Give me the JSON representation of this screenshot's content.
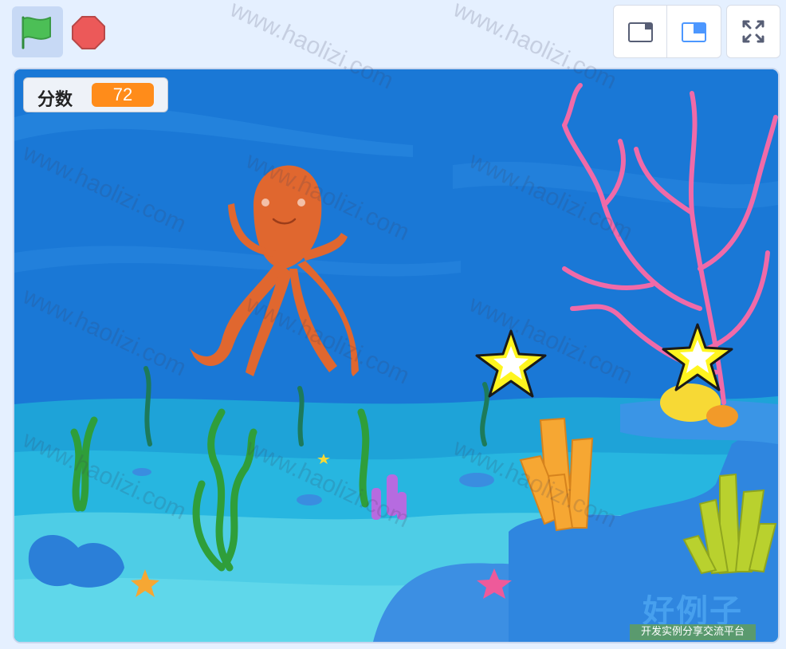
{
  "toolbar": {
    "green_flag": {
      "icon": "green-flag-icon",
      "color": "#4cbf56"
    },
    "stop": {
      "icon": "stop-sign-icon",
      "color": "#ec5959"
    },
    "small_stage": {
      "icon": "small-stage-icon"
    },
    "large_stage": {
      "icon": "large-stage-icon",
      "selected": true,
      "accent": "#4c97ff"
    },
    "fullscreen": {
      "icon": "fullscreen-icon"
    }
  },
  "variable_monitor": {
    "label": "分数",
    "value": "72",
    "value_color": "#ff8c1a"
  },
  "watermark": {
    "text": "www.haolizi.com",
    "brand_name": "好例子网",
    "brand_tagline": "开发实例分享交流平台"
  },
  "scene": {
    "sprites": [
      "octopus-sprite",
      "starfish-sprite-1",
      "starfish-sprite-2"
    ],
    "colors": {
      "water": "#1a78d6",
      "sand": "#4ecde6",
      "coral": "#f06aa8",
      "octopus": "#e0672f",
      "star": "#fff51f"
    }
  }
}
